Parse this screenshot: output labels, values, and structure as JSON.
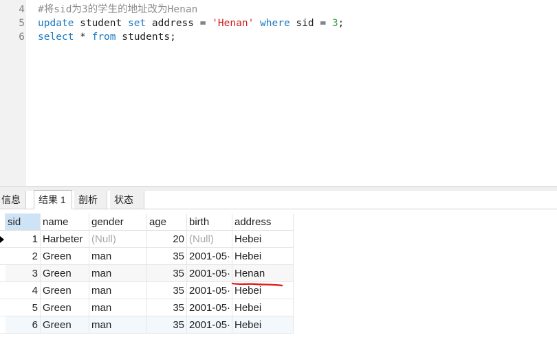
{
  "editor": {
    "lines": [
      {
        "num": "4",
        "text": "#将sid为3的学生的地址改为Henan"
      },
      {
        "num": "5",
        "tokens": [
          {
            "t": "update",
            "k": "kw"
          },
          {
            "t": " student ",
            "k": "plain"
          },
          {
            "t": "set",
            "k": "kw"
          },
          {
            "t": " address = ",
            "k": "plain"
          },
          {
            "t": "'Henan'",
            "k": "str"
          },
          {
            "t": " ",
            "k": "plain"
          },
          {
            "t": "where",
            "k": "kw"
          },
          {
            "t": " sid = ",
            "k": "plain"
          },
          {
            "t": "3",
            "k": "num"
          },
          {
            "t": ";",
            "k": "plain"
          }
        ]
      },
      {
        "num": "6",
        "tokens": [
          {
            "t": "select",
            "k": "kw"
          },
          {
            "t": " * ",
            "k": "plain"
          },
          {
            "t": "from",
            "k": "kw"
          },
          {
            "t": " students;",
            "k": "plain"
          }
        ]
      }
    ]
  },
  "tabs": [
    {
      "label": "信息",
      "active": false
    },
    {
      "label": "结果 1",
      "active": true
    },
    {
      "label": "剖析",
      "active": false
    },
    {
      "label": "状态",
      "active": false
    }
  ],
  "table": {
    "columns": [
      "sid",
      "name",
      "gender",
      "age",
      "birth",
      "address"
    ],
    "selected_column": "sid",
    "rows": [
      {
        "sid": "1",
        "name": "Harbeter",
        "gender": "(Null)",
        "age": "20",
        "birth": "(Null)",
        "address": "Hebei",
        "current": true
      },
      {
        "sid": "2",
        "name": "Green",
        "gender": "man",
        "age": "35",
        "birth": "2001-05·",
        "address": "Hebei"
      },
      {
        "sid": "3",
        "name": "Green",
        "gender": "man",
        "age": "35",
        "birth": "2001-05·",
        "address": "Henan",
        "underlined": true
      },
      {
        "sid": "4",
        "name": "Green",
        "gender": "man",
        "age": "35",
        "birth": "2001-05·",
        "address": "Hebei"
      },
      {
        "sid": "5",
        "name": "Green",
        "gender": "man",
        "age": "35",
        "birth": "2001-05·",
        "address": "Hebei"
      },
      {
        "sid": "6",
        "name": "Green",
        "gender": "man",
        "age": "35",
        "birth": "2001-05·",
        "address": "Hebei"
      }
    ]
  },
  "colors": {
    "keyword": "#1a78c2",
    "string": "#d11a1a",
    "number": "#3aa14a",
    "comment": "#8c8c8c",
    "annotation": "#e02020",
    "selected_header": "#cfe3f7"
  }
}
